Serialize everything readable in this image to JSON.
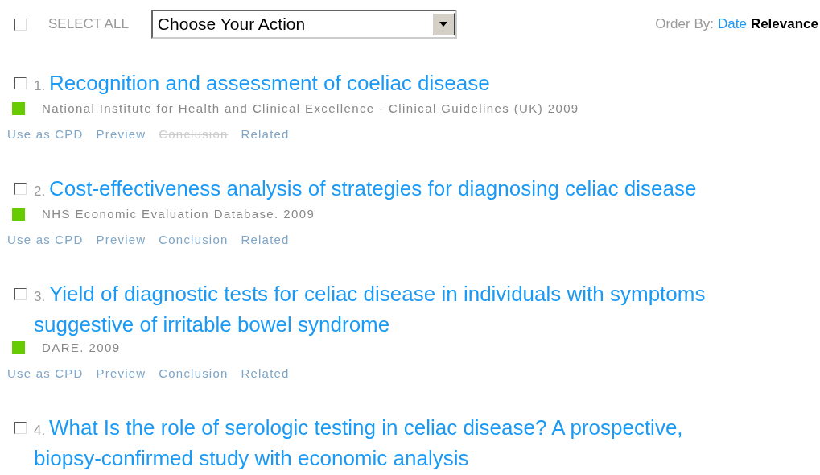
{
  "toolbar": {
    "select_all": {
      "label": "SELECT ALL",
      "checked": false
    },
    "action": {
      "value": "Choose Your Action"
    },
    "order_by": {
      "label": "Order By:",
      "options": [
        {
          "label": "Date",
          "selected": false
        },
        {
          "label": "Relevance",
          "selected": true
        }
      ]
    }
  },
  "results": [
    {
      "number": "1.",
      "title": "Recognition and assessment of coeliac disease",
      "checked": false,
      "color": "#66cc00",
      "source": "National Institute for Health and Clinical Excellence - Clinical Guidelines (UK)",
      "year": "2009",
      "links": [
        {
          "label": "Use as CPD",
          "disabled": false
        },
        {
          "label": "Preview",
          "disabled": false
        },
        {
          "label": "Conclusion",
          "disabled": true
        },
        {
          "label": "Related",
          "disabled": false
        }
      ]
    },
    {
      "number": "2.",
      "title": "Cost-effectiveness analysis of strategies for diagnosing celiac disease",
      "checked": false,
      "color": "#66cc00",
      "source": "NHS Economic Evaluation Database.",
      "year": "2009",
      "links": [
        {
          "label": "Use as CPD",
          "disabled": false
        },
        {
          "label": "Preview",
          "disabled": false
        },
        {
          "label": "Conclusion",
          "disabled": false
        },
        {
          "label": "Related",
          "disabled": false
        }
      ]
    },
    {
      "number": "3.",
      "title": "Yield of diagnostic tests for celiac disease in individuals with symptoms suggestive of irritable bowel syndrome",
      "checked": false,
      "color": "#66cc00",
      "source": "DARE.",
      "year": "2009",
      "links": [
        {
          "label": "Use as CPD",
          "disabled": false
        },
        {
          "label": "Preview",
          "disabled": false
        },
        {
          "label": "Conclusion",
          "disabled": false
        },
        {
          "label": "Related",
          "disabled": false
        }
      ]
    },
    {
      "number": "4.",
      "title": "What Is the role of serologic testing in celiac disease? A prospective, biopsy-confirmed study with economic analysis",
      "checked": false
    }
  ]
}
